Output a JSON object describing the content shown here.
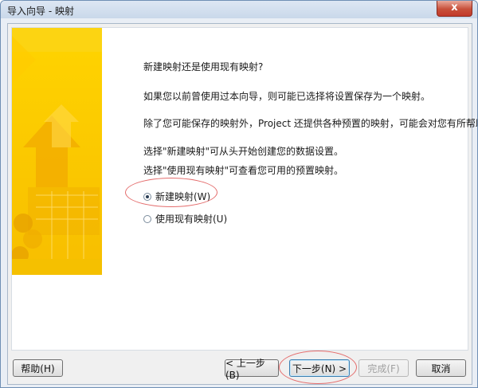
{
  "window": {
    "title": "导入向导 - 映射",
    "close_label": "x"
  },
  "content": {
    "question": "新建映射还是使用现有映射?",
    "para1": "如果您以前曾使用过本向导，则可能已选择将设置保存为一个映射。",
    "para2": "除了您可能保存的映射外，Project 还提供各种预置的映射，可能会对您有所帮助。",
    "hint1": "选择\"新建映射\"可从头开始创建您的数据设置。",
    "hint2": "选择\"使用现有映射\"可查看您可用的预置映射。"
  },
  "options": {
    "new_map": {
      "label": "新建映射(W)",
      "selected": true
    },
    "use_existing": {
      "label": "使用现有映射(U)",
      "selected": false
    }
  },
  "buttons": {
    "help": "帮助(H)",
    "back": "< 上一步(B)",
    "next": "下一步(N) >",
    "finish": "完成(F)",
    "cancel": "取消"
  },
  "colors": {
    "accent_yellow": "#f7c600",
    "highlight_ellipse": "#e46d6d"
  }
}
